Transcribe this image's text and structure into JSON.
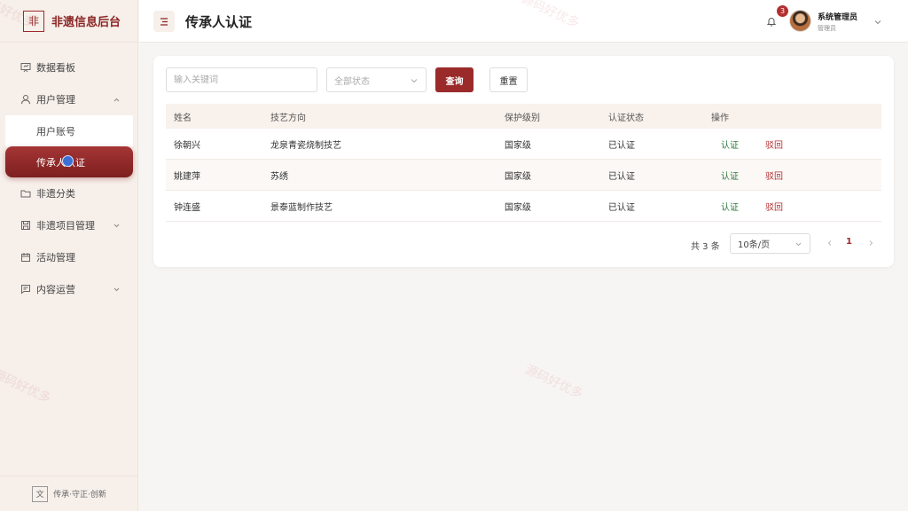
{
  "app": {
    "logo_char": "非",
    "title": "非遗信息后台"
  },
  "sidebar": {
    "items": [
      {
        "label": "数据看板",
        "icon": "presentation-icon"
      },
      {
        "label": "用户管理",
        "icon": "user-icon",
        "expanded": true,
        "children": [
          {
            "label": "用户账号"
          },
          {
            "label": "传承人认证",
            "active": true
          }
        ]
      },
      {
        "label": "非遗分类",
        "icon": "folder-icon"
      },
      {
        "label": "非遗项目管理",
        "icon": "save-icon"
      },
      {
        "label": "活动管理",
        "icon": "calendar-icon"
      },
      {
        "label": "内容运营",
        "icon": "message-icon"
      }
    ],
    "footer_char": "文",
    "footer_text": "传承·守正·创新"
  },
  "header": {
    "title": "传承人认证",
    "notification_count": "3",
    "user_name": "系统管理员",
    "user_role": "管理员"
  },
  "filters": {
    "keyword_placeholder": "输入关键词",
    "status_placeholder": "全部状态",
    "query_label": "查询",
    "reset_label": "重置"
  },
  "table": {
    "columns": [
      "姓名",
      "技艺方向",
      "保护级别",
      "认证状态",
      "操作"
    ],
    "rows": [
      {
        "name": "徐朝兴",
        "craft": "龙泉青瓷烧制技艺",
        "level": "国家级",
        "status": "已认证"
      },
      {
        "name": "姚建萍",
        "craft": "苏绣",
        "level": "国家级",
        "status": "已认证"
      },
      {
        "name": "钟连盛",
        "craft": "景泰蓝制作技艺",
        "level": "国家级",
        "status": "已认证"
      }
    ],
    "action_approve": "认证",
    "action_reject": "驳回"
  },
  "pagination": {
    "total": "共 3 条",
    "page_size": "10条/页",
    "current_page": "1"
  },
  "watermark": "源码好优多",
  "colors": {
    "brand": "#9b2b2b",
    "approve": "#2f7a3e",
    "reject": "#b33030"
  }
}
